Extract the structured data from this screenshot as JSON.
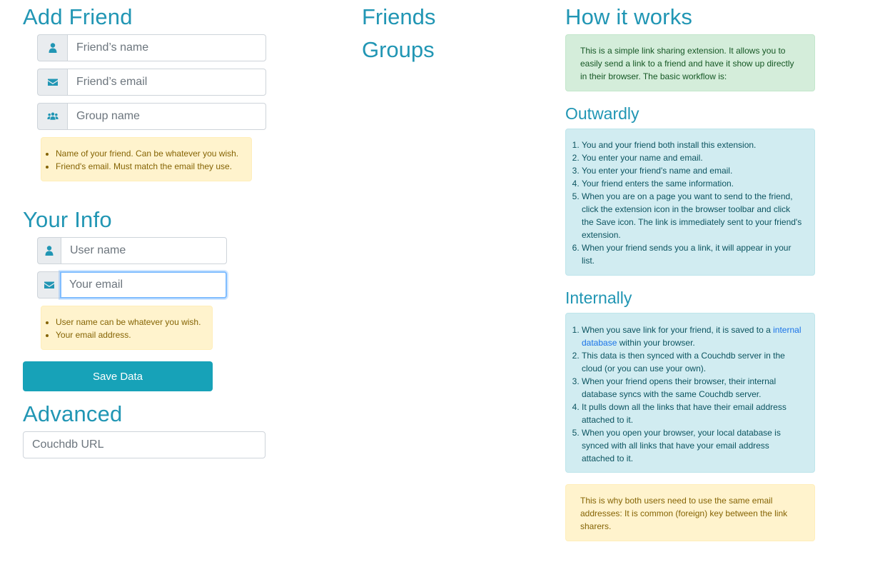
{
  "add_friend": {
    "title": "Add Friend",
    "name_placeholder": "Friend’s name",
    "email_placeholder": "Friend’s email",
    "group_placeholder": "Group name",
    "hints": [
      "Name of your friend. Can be whatever you wish.",
      "Friend's email. Must match the email they use."
    ]
  },
  "your_info": {
    "title": "Your Info",
    "username_placeholder": "User name",
    "email_placeholder": "Your email",
    "hints": [
      "User name can be whatever you wish.",
      "Your email address."
    ]
  },
  "save_button": "Save Data",
  "advanced": {
    "title": "Advanced",
    "couchdb_placeholder": "Couchdb URL"
  },
  "nav": {
    "friends": "Friends",
    "groups": "Groups"
  },
  "how_it_works": {
    "title": "How it works",
    "intro": "This is a simple link sharing extension. It allows you to easily send a link to a friend and have it show up directly in their browser. The basic workflow is:",
    "outwardly_title": "Outwardly",
    "outwardly_steps": [
      "You and your friend both install this extension.",
      "You enter your name and email.",
      "You enter your friend's name and email.",
      "Your friend enters the same information.",
      "When you are on a page you want to send to the friend, click the extension icon in the browser toolbar and click the Save icon. The link is immediately sent to your friend's extension.",
      "When your friend sends you a link, it will appear in your list."
    ],
    "internally_title": "Internally",
    "internally_step1_before": "When you save link for your friend, it is saved to a ",
    "internally_step1_link": "internal database",
    "internally_step1_after": " within your browser.",
    "internally_steps_rest": [
      "This data is then synced with a Couchdb server in the cloud (or you can use your own).",
      "When your friend opens their browser, their internal database syncs with the same Couchdb server.",
      "It pulls down all the links that have their email address attached to it.",
      "When you open your browser, your local database is synced with all links that have your email address attached to it."
    ],
    "note": "This is why both users need to use the same email addresses: It is common (foreign) key between the link sharers."
  },
  "colors": {
    "heading": "#2196b4",
    "button": "#17a2b8",
    "warning_bg": "#fff3cd",
    "success_bg": "#d4edda",
    "info_bg": "#d1ecf1",
    "link": "#1a73e8"
  },
  "icons": [
    "user-icon",
    "envelope-icon",
    "users-icon"
  ]
}
